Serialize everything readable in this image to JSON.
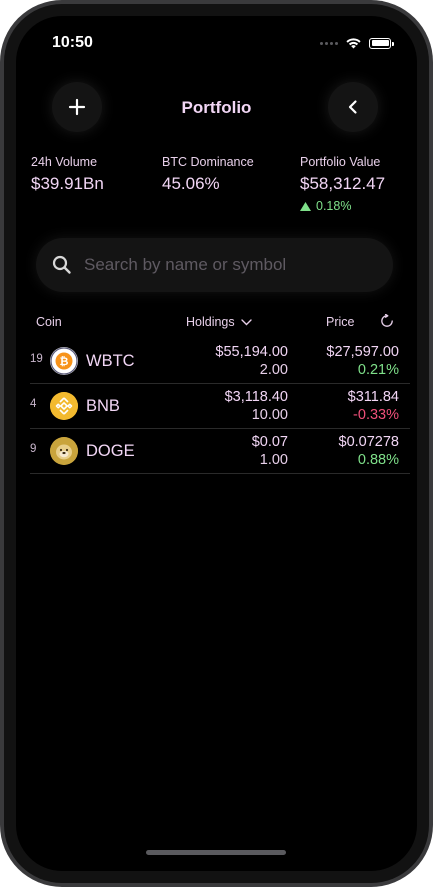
{
  "status": {
    "time": "10:50"
  },
  "header": {
    "title": "Portfolio"
  },
  "stats": [
    {
      "label": "24h Volume",
      "value": "$39.91Bn"
    },
    {
      "label": "BTC Dominance",
      "value": "45.06%"
    },
    {
      "label": "Portfolio Value",
      "value": "$58,312.47",
      "change": "0.18%"
    }
  ],
  "search": {
    "placeholder": "Search by name or symbol",
    "value": ""
  },
  "columns": {
    "coin": "Coin",
    "holdings": "Holdings",
    "price": "Price"
  },
  "coins": [
    {
      "rank": "19",
      "symbol": "WBTC",
      "holdings_value": "$55,194.00",
      "holdings_qty": "2.00",
      "price": "$27,597.00",
      "change": "0.21%",
      "change_direction": "up",
      "icon": "wbtc-icon"
    },
    {
      "rank": "4",
      "symbol": "BNB",
      "holdings_value": "$3,118.40",
      "holdings_qty": "10.00",
      "price": "$311.84",
      "change": "-0.33%",
      "change_direction": "down",
      "icon": "bnb-icon"
    },
    {
      "rank": "9",
      "symbol": "DOGE",
      "holdings_value": "$0.07",
      "holdings_qty": "1.00",
      "price": "$0.07278",
      "change": "0.88%",
      "change_direction": "up",
      "icon": "doge-icon"
    }
  ],
  "colors": {
    "background": "#000000",
    "text_accent": "#f2d6f5",
    "positive": "#7fe08a",
    "negative": "#f0507a"
  }
}
